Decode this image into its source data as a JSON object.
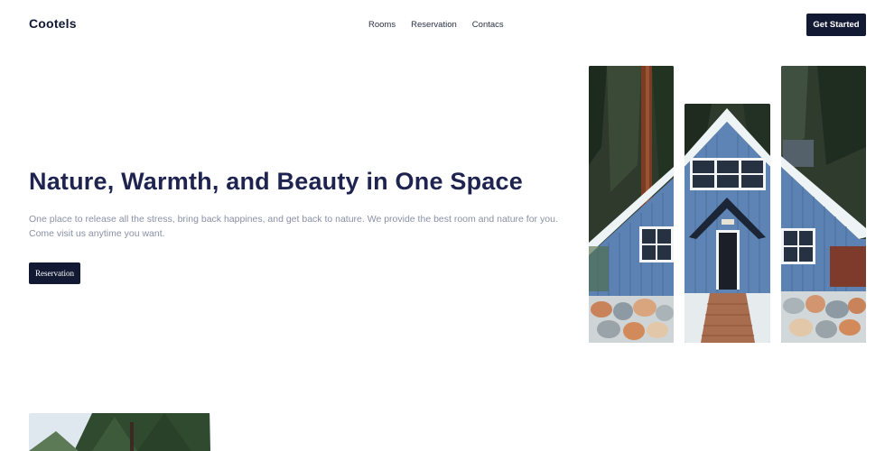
{
  "header": {
    "logo": "Cootels",
    "nav": [
      "Rooms",
      "Reservation",
      "Contacs"
    ],
    "cta_label": "Get Started"
  },
  "hero": {
    "title": "Nature, Warmth, and Beauty in One Space",
    "description": "One place to release all the stress, bring back happines, and get back to nature. We provide the best room and nature for you. Come visit us anytime you want.",
    "button_label": "Reservation"
  },
  "images": {
    "cabin": "blue-cabin-in-forest",
    "bottom": "forest-trees"
  },
  "colors": {
    "primary_dark": "#121a33",
    "title": "#1e2350",
    "muted_text": "#8a90a6"
  }
}
